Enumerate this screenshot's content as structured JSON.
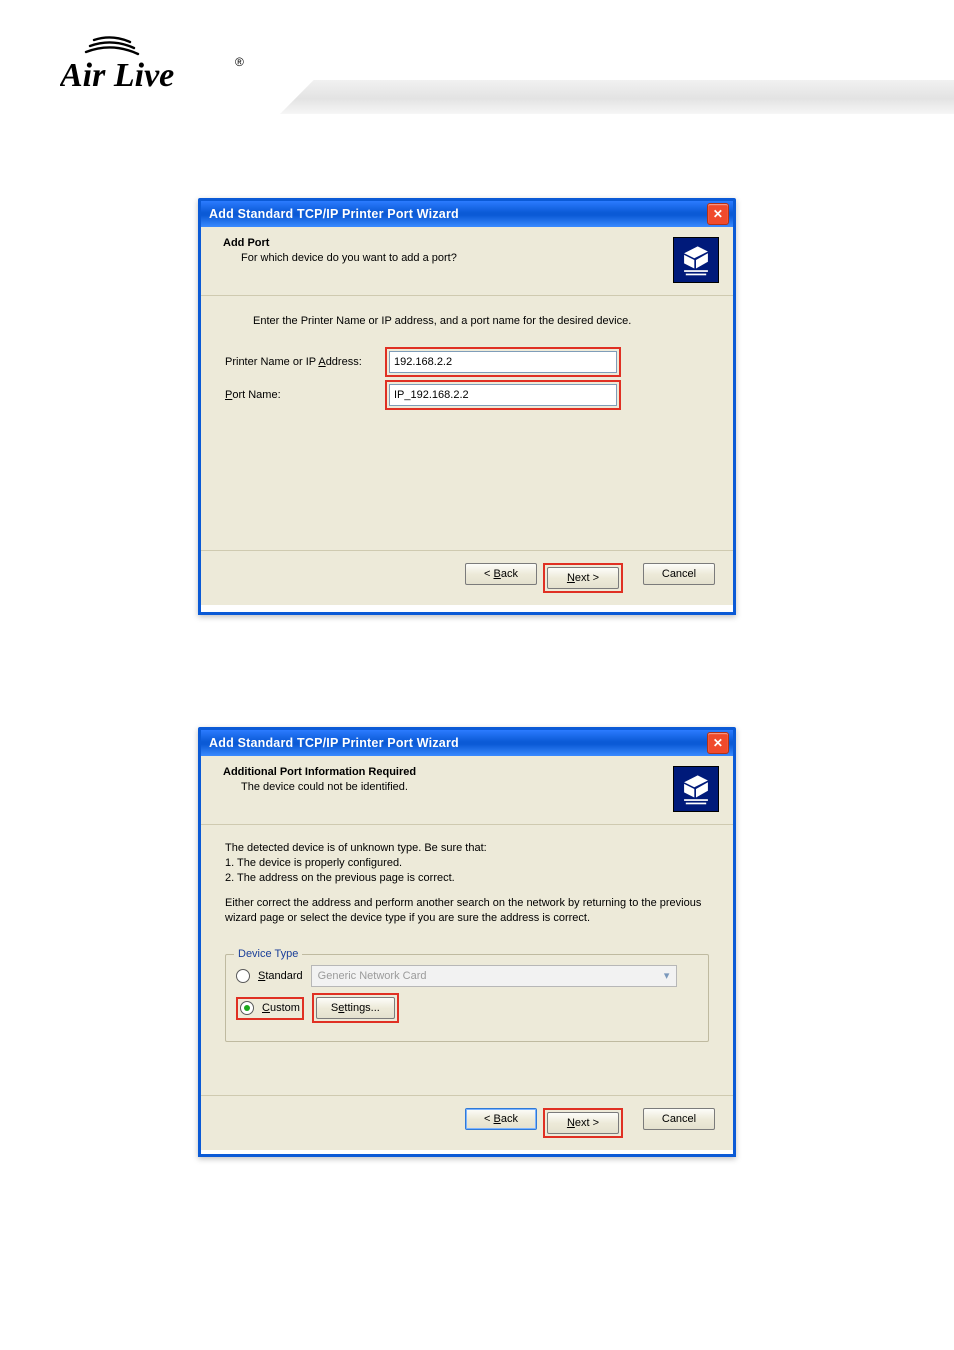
{
  "brand": {
    "name": "Air Live"
  },
  "dialog1": {
    "title": "Add Standard TCP/IP Printer Port Wizard",
    "header_title": "Add Port",
    "header_sub": "For which device do you want to add a port?",
    "instruction": "Enter the Printer Name or IP address, and a port name for the desired device.",
    "label_ip_pre": "Printer Name or IP ",
    "label_ip_u": "A",
    "label_ip_post": "ddress:",
    "label_port_u": "P",
    "label_port_post": "ort Name:",
    "value_ip": "192.168.2.2",
    "value_port": "IP_192.168.2.2",
    "btn_back_pre": "< ",
    "btn_back_u": "B",
    "btn_back_post": "ack",
    "btn_next_u": "N",
    "btn_next_post": "ext >",
    "btn_cancel": "Cancel"
  },
  "dialog2": {
    "title": "Add Standard TCP/IP Printer Port Wizard",
    "header_title": "Additional Port Information Required",
    "header_sub": "The device could not be identified.",
    "para1_l1": "The detected device is of unknown type.  Be sure that:",
    "para1_l2": "1. The device is properly configured.",
    "para1_l3": "2.  The address on the previous page is correct.",
    "para2": "Either correct the address and perform another search on the network by returning to the previous wizard page or select the device type if you are sure the address is correct.",
    "fieldset": {
      "legend": "Device Type",
      "radio_standard_u": "S",
      "radio_standard_post": "tandard",
      "combo_value": "Generic Network Card",
      "radio_custom_u": "C",
      "radio_custom_post": "ustom",
      "btn_settings_pre": "S",
      "btn_settings_u": "e",
      "btn_settings_post": "ttings..."
    },
    "btn_back_pre": "< ",
    "btn_back_u": "B",
    "btn_back_post": "ack",
    "btn_next_u": "N",
    "btn_next_post": "ext >",
    "btn_cancel": "Cancel"
  }
}
